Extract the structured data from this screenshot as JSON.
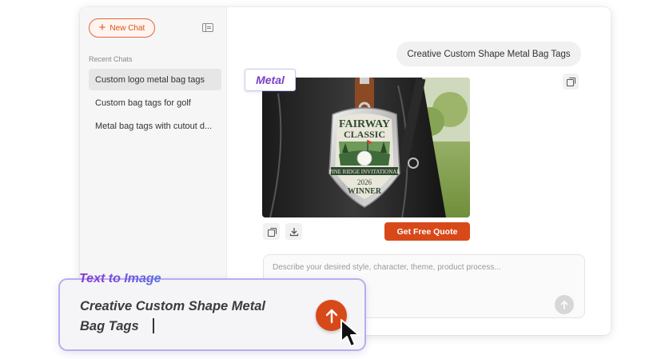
{
  "sidebar": {
    "new_chat_label": "New Chat",
    "recent_label": "Recent Chats",
    "items": [
      {
        "label": "Custom logo metal bag tags",
        "active": true
      },
      {
        "label": "Custom bag tags for golf",
        "active": false
      },
      {
        "label": "Metal bag tags with cutout d...",
        "active": false
      }
    ]
  },
  "chat": {
    "user_message": "Creative Custom Shape Metal Bag Tags",
    "quote_button": "Get Free Quote",
    "prompt_placeholder": "Describe your desired style, character, theme, product process..."
  },
  "image": {
    "tag_line1": "FAIRWAY",
    "tag_line2": "CLASSIC",
    "ribbon": "PINE RIDGE INVITATIONAL",
    "year": "2026",
    "award": "WINNER"
  },
  "overlay": {
    "metal_label": "Metal",
    "mode_label": "Text to Image",
    "prompt_text": "Creative Custom Shape Metal Bag Tags"
  },
  "colors": {
    "accent": "#d8491a",
    "mode_label": "#7b3fd6"
  },
  "icons": [
    "plus-icon",
    "sidebar-toggle-icon",
    "copy-icon",
    "download-icon",
    "arrow-up-icon",
    "cursor-icon"
  ]
}
